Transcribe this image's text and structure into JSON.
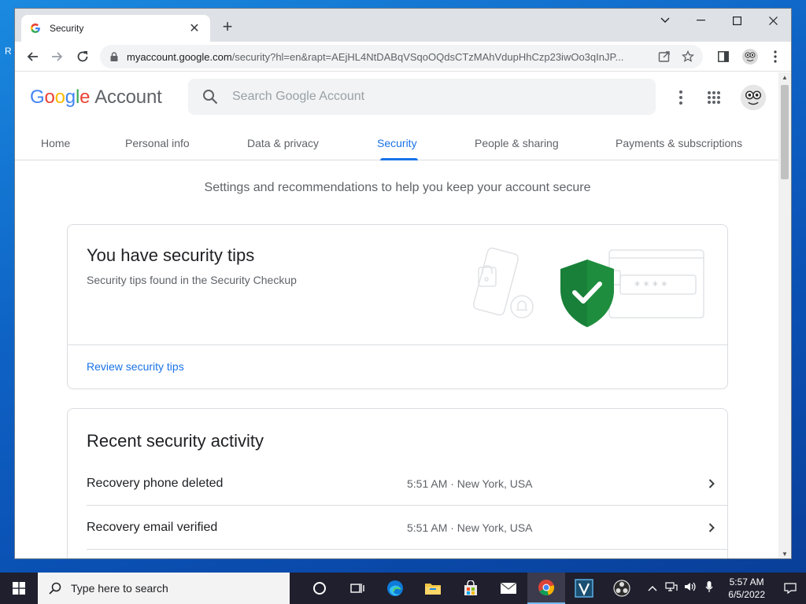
{
  "browser": {
    "tab_title": "Security",
    "url_host": "myaccount.google.com",
    "url_path": "/security?hl=en&rapt=AEjHL4NtDABqVSqoOQdsCTzMAhVdupHhCzp23iwOo3qInJP..."
  },
  "header": {
    "logo_account": "Account",
    "search_placeholder": "Search Google Account"
  },
  "nav": {
    "items": [
      {
        "label": "Home"
      },
      {
        "label": "Personal info"
      },
      {
        "label": "Data & privacy"
      },
      {
        "label": "Security"
      },
      {
        "label": "People & sharing"
      },
      {
        "label": "Payments & subscriptions"
      }
    ],
    "active": "Security"
  },
  "intro": "Settings and recommendations to help you keep your account secure",
  "tips_card": {
    "title": "You have security tips",
    "subtitle": "Security tips found in the Security Checkup",
    "link": "Review security tips"
  },
  "activity_card": {
    "title": "Recent security activity",
    "rows": [
      {
        "label": "Recovery phone deleted",
        "meta": "5:51 AM · New York, USA"
      },
      {
        "label": "Recovery email verified",
        "meta": "5:51 AM · New York, USA"
      }
    ]
  },
  "taskbar": {
    "search_text": "Type here to search",
    "time": "5:57 AM",
    "date": "6/5/2022"
  },
  "colors": {
    "accent": "#1a73e8",
    "shield": "#1e8e3e"
  }
}
